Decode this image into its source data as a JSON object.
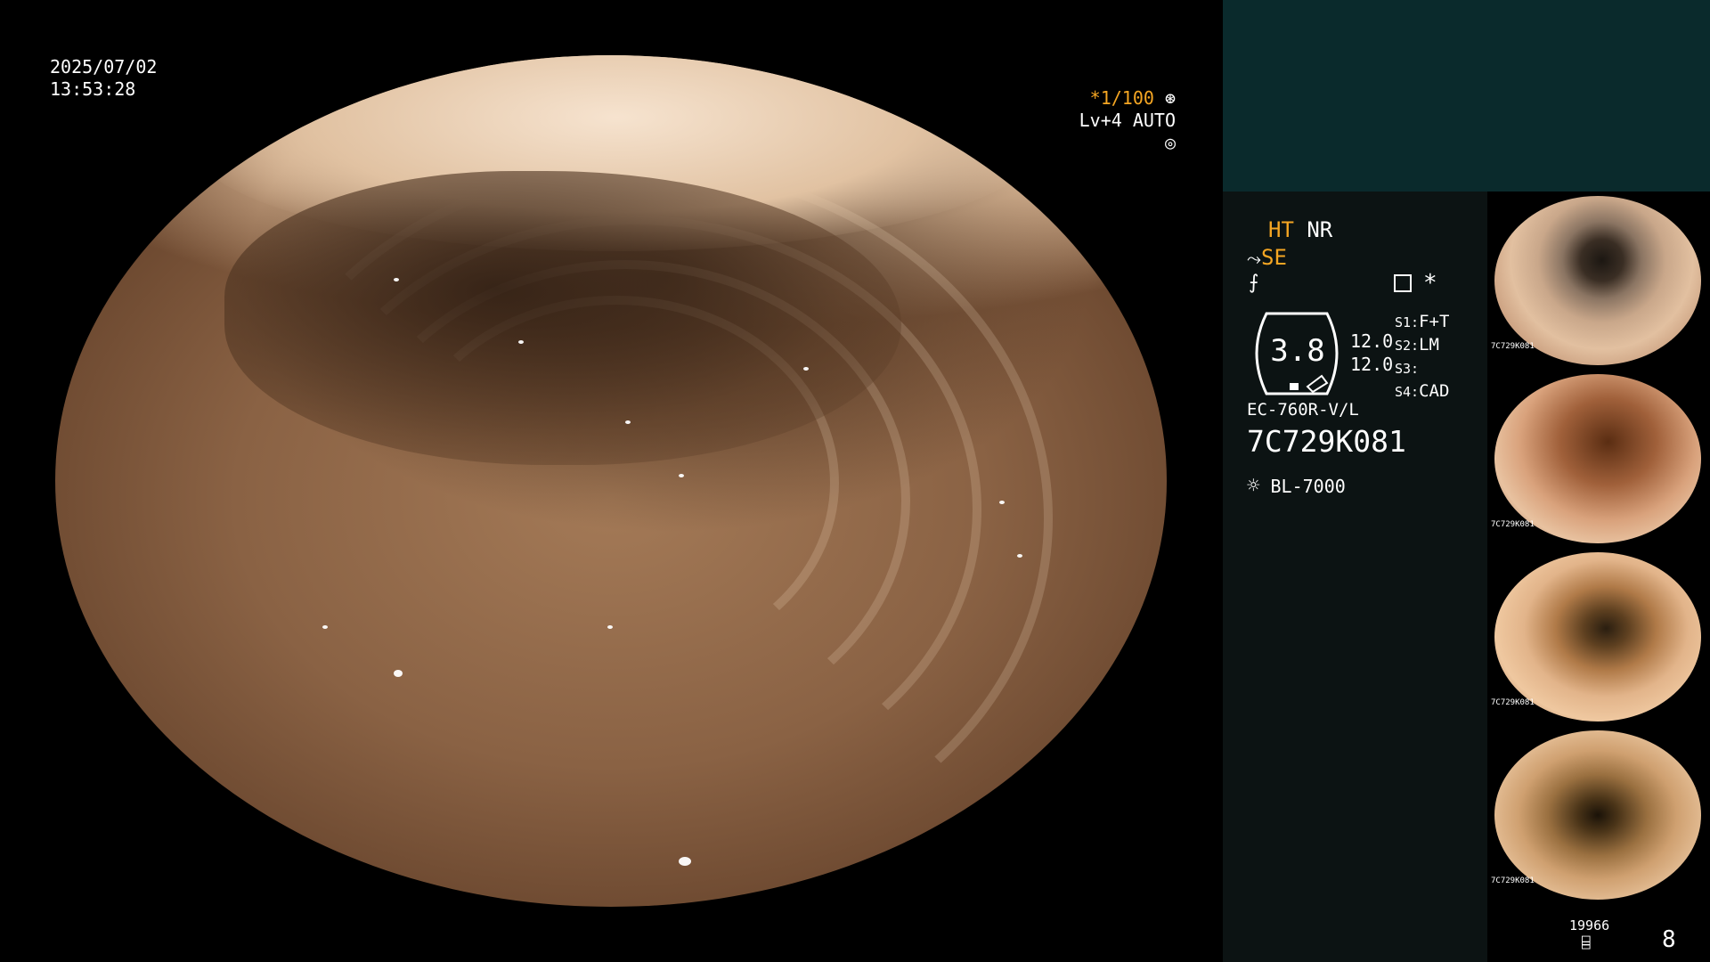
{
  "overlay": {
    "date": "2025/07/02",
    "time": "13:53:28",
    "shutter": "*1/100",
    "level": "Lv+4 AUTO"
  },
  "settings": {
    "ht": "HT",
    "nr": "NR",
    "se": "SE",
    "star": "*",
    "scale_value": "3.8",
    "val1": "12.0",
    "val2": "12.0",
    "s1_label": "S1:",
    "s1_value": "F+T",
    "s2_label": "S2:",
    "s2_value": "LM",
    "s3_label": "S3:",
    "s3_value": "",
    "s4_label": "S4:",
    "s4_value": "CAD",
    "scope_model": "EC-760R-V/L",
    "scope_serial": "7C729K081",
    "light_source": "BL-7000"
  },
  "storage": {
    "count": "19966",
    "captured": "8"
  },
  "thumbnails": [
    {
      "tag": "7C729K081"
    },
    {
      "tag": "7C729K081"
    },
    {
      "tag": "7C729K081"
    },
    {
      "tag": "7C729K081"
    }
  ],
  "colors": {
    "accent": "#f5a623",
    "panel_top": "#0a2a2c",
    "panel_side": "#0c1313"
  }
}
